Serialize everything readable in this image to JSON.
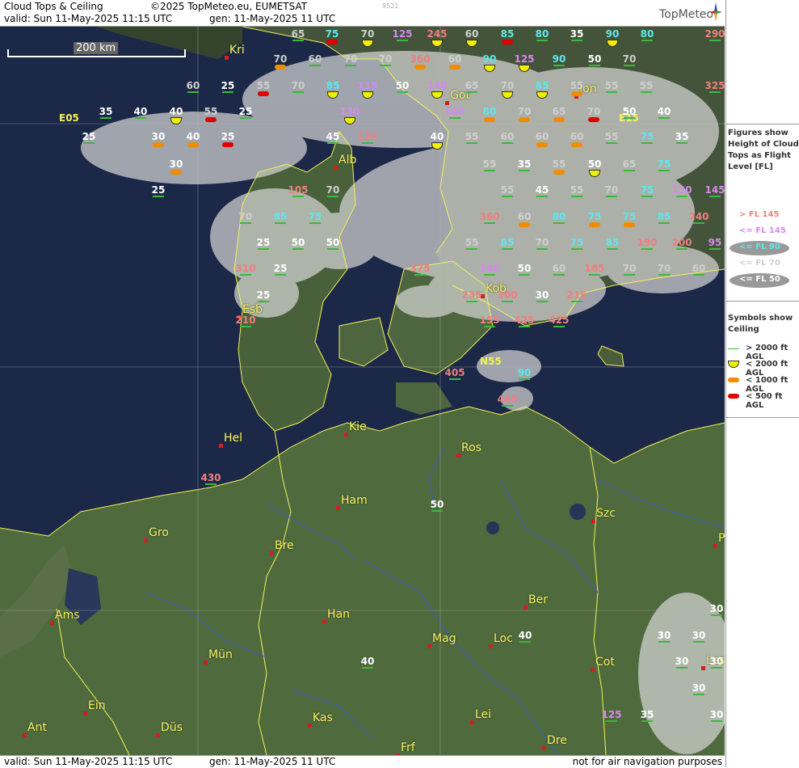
{
  "header": {
    "title": "Cloud Tops & Ceiling",
    "copyright": "©2025 TopMeteo.eu, EUMETSAT",
    "id": "9521",
    "valid": "valid:  Sun  11-May-2025  11:15 UTC",
    "generated": "gen: 11-May-2025 11 UTC",
    "brand": "TopMeteo"
  },
  "map": {
    "scale_label": "200 km",
    "grid_labels": [
      {
        "id": "e05",
        "text": "E05"
      },
      {
        "id": "e15",
        "text": "E15"
      },
      {
        "id": "n55",
        "text": "N55"
      }
    ],
    "cities": [
      {
        "name": "Kri"
      },
      {
        "name": "Got"
      },
      {
        "name": "Jon"
      },
      {
        "name": "Alb"
      },
      {
        "name": "Esb"
      },
      {
        "name": "Kob"
      },
      {
        "name": "Hel"
      },
      {
        "name": "Kie"
      },
      {
        "name": "Ros"
      },
      {
        "name": "Ham"
      },
      {
        "name": "Szc"
      },
      {
        "name": "Gro"
      },
      {
        "name": "Bre"
      },
      {
        "name": "Ber"
      },
      {
        "name": "Ams"
      },
      {
        "name": "Han"
      },
      {
        "name": "Mün"
      },
      {
        "name": "Mag"
      },
      {
        "name": "Loc"
      },
      {
        "name": "Cot"
      },
      {
        "name": "Ein"
      },
      {
        "name": "Kas"
      },
      {
        "name": "Lei"
      },
      {
        "name": "Ant"
      },
      {
        "name": "Düs"
      },
      {
        "name": "Frf"
      },
      {
        "name": "Dre"
      },
      {
        "name": "Les"
      },
      {
        "name": "Po"
      }
    ],
    "cloud_tops": [
      {
        "v": "65",
        "c": "gray",
        "s": "green"
      },
      {
        "v": "75",
        "c": "cyan",
        "s": "red"
      },
      {
        "v": "70",
        "c": "gray",
        "s": "yellow"
      },
      {
        "v": "125",
        "c": "purple",
        "s": "green"
      },
      {
        "v": "245",
        "c": "pink",
        "s": "yellow"
      },
      {
        "v": "60",
        "c": "gray",
        "s": "yellow"
      },
      {
        "v": "85",
        "c": "cyan",
        "s": "red"
      },
      {
        "v": "80",
        "c": "cyan",
        "s": "green"
      },
      {
        "v": "35",
        "c": "white",
        "s": "green"
      },
      {
        "v": "90",
        "c": "cyan",
        "s": "yellow"
      },
      {
        "v": "80",
        "c": "cyan",
        "s": "green"
      },
      {
        "v": "290",
        "c": "pink",
        "s": "green"
      },
      {
        "v": "70",
        "c": "gray",
        "s": "orange"
      },
      {
        "v": "60",
        "c": "gray",
        "s": "green"
      },
      {
        "v": "70",
        "c": "gray",
        "s": "green"
      },
      {
        "v": "70",
        "c": "gray",
        "s": "green"
      },
      {
        "v": "360",
        "c": "pink",
        "s": "orange"
      },
      {
        "v": "60",
        "c": "gray",
        "s": "orange"
      },
      {
        "v": "90",
        "c": "cyan",
        "s": "yellow"
      },
      {
        "v": "125",
        "c": "purple",
        "s": "yellow"
      },
      {
        "v": "90",
        "c": "cyan",
        "s": "green"
      },
      {
        "v": "50",
        "c": "white",
        "s": "green"
      },
      {
        "v": "70",
        "c": "gray",
        "s": "green"
      },
      {
        "v": "60",
        "c": "gray",
        "s": "green"
      },
      {
        "v": "25",
        "c": "white",
        "s": "green"
      },
      {
        "v": "55",
        "c": "gray",
        "s": "red"
      },
      {
        "v": "70",
        "c": "gray",
        "s": "green"
      },
      {
        "v": "85",
        "c": "cyan",
        "s": "yellow"
      },
      {
        "v": "115",
        "c": "purple",
        "s": "yellow"
      },
      {
        "v": "50",
        "c": "white",
        "s": "green"
      },
      {
        "v": "140",
        "c": "purple",
        "s": "yellow"
      },
      {
        "v": "65",
        "c": "gray",
        "s": "green"
      },
      {
        "v": "70",
        "c": "gray",
        "s": "yellow"
      },
      {
        "v": "85",
        "c": "cyan",
        "s": "yellow"
      },
      {
        "v": "55",
        "c": "gray",
        "s": "orange"
      },
      {
        "v": "55",
        "c": "gray",
        "s": "green"
      },
      {
        "v": "55",
        "c": "gray",
        "s": "green"
      },
      {
        "v": "325",
        "c": "pink",
        "s": "green"
      },
      {
        "v": "35",
        "c": "white",
        "s": "green"
      },
      {
        "v": "40",
        "c": "white",
        "s": "green"
      },
      {
        "v": "40",
        "c": "white",
        "s": "yellow"
      },
      {
        "v": "55",
        "c": "gray",
        "s": "red"
      },
      {
        "v": "25",
        "c": "white",
        "s": "green"
      },
      {
        "v": "130",
        "c": "purple",
        "s": "yellow"
      },
      {
        "v": "140",
        "c": "purple",
        "s": "green"
      },
      {
        "v": "80",
        "c": "cyan",
        "s": "orange"
      },
      {
        "v": "70",
        "c": "gray",
        "s": "orange"
      },
      {
        "v": "65",
        "c": "gray",
        "s": "orange"
      },
      {
        "v": "70",
        "c": "gray",
        "s": "red"
      },
      {
        "v": "50",
        "c": "white",
        "s": "green"
      },
      {
        "v": "40",
        "c": "white",
        "s": "green"
      },
      {
        "v": "25",
        "c": "white",
        "s": "green"
      },
      {
        "v": "30",
        "c": "white",
        "s": "orange"
      },
      {
        "v": "40",
        "c": "white",
        "s": "orange"
      },
      {
        "v": "25",
        "c": "white",
        "s": "red"
      },
      {
        "v": "45",
        "c": "white",
        "s": "green"
      },
      {
        "v": "135",
        "c": "pink",
        "s": "green"
      },
      {
        "v": "40",
        "c": "white",
        "s": "yellow"
      },
      {
        "v": "55",
        "c": "gray",
        "s": "green"
      },
      {
        "v": "60",
        "c": "gray",
        "s": "green"
      },
      {
        "v": "60",
        "c": "gray",
        "s": "orange"
      },
      {
        "v": "60",
        "c": "gray",
        "s": "orange"
      },
      {
        "v": "55",
        "c": "gray",
        "s": "green"
      },
      {
        "v": "75",
        "c": "cyan",
        "s": "green"
      },
      {
        "v": "35",
        "c": "white",
        "s": "green"
      },
      {
        "v": "30",
        "c": "white",
        "s": "orange"
      },
      {
        "v": "55",
        "c": "gray",
        "s": "green"
      },
      {
        "v": "35",
        "c": "white",
        "s": "green"
      },
      {
        "v": "55",
        "c": "gray",
        "s": "orange"
      },
      {
        "v": "50",
        "c": "white",
        "s": "yellow"
      },
      {
        "v": "65",
        "c": "gray",
        "s": "green"
      },
      {
        "v": "75",
        "c": "cyan",
        "s": "green"
      },
      {
        "v": "25",
        "c": "white",
        "s": "green"
      },
      {
        "v": "105",
        "c": "pink",
        "s": "green"
      },
      {
        "v": "70",
        "c": "gray",
        "s": "green"
      },
      {
        "v": "55",
        "c": "gray",
        "s": "green"
      },
      {
        "v": "45",
        "c": "white",
        "s": "green"
      },
      {
        "v": "55",
        "c": "gray",
        "s": "green"
      },
      {
        "v": "70",
        "c": "gray",
        "s": "green"
      },
      {
        "v": "75",
        "c": "cyan",
        "s": "green"
      },
      {
        "v": "130",
        "c": "purple",
        "s": "green"
      },
      {
        "v": "145",
        "c": "purple",
        "s": "green"
      },
      {
        "v": "70",
        "c": "gray",
        "s": "green"
      },
      {
        "v": "85",
        "c": "cyan",
        "s": "green"
      },
      {
        "v": "75",
        "c": "cyan",
        "s": "green"
      },
      {
        "v": "360",
        "c": "pink",
        "s": "green"
      },
      {
        "v": "60",
        "c": "gray",
        "s": "orange"
      },
      {
        "v": "80",
        "c": "cyan",
        "s": "green"
      },
      {
        "v": "75",
        "c": "cyan",
        "s": "orange"
      },
      {
        "v": "75",
        "c": "cyan",
        "s": "orange"
      },
      {
        "v": "85",
        "c": "cyan",
        "s": "green"
      },
      {
        "v": "240",
        "c": "pink",
        "s": "green"
      },
      {
        "v": "25",
        "c": "white",
        "s": "green"
      },
      {
        "v": "50",
        "c": "white",
        "s": "green"
      },
      {
        "v": "50",
        "c": "white",
        "s": "green"
      },
      {
        "v": "55",
        "c": "gray",
        "s": "green"
      },
      {
        "v": "85",
        "c": "cyan",
        "s": "green"
      },
      {
        "v": "70",
        "c": "gray",
        "s": "green"
      },
      {
        "v": "75",
        "c": "cyan",
        "s": "green"
      },
      {
        "v": "85",
        "c": "cyan",
        "s": "green"
      },
      {
        "v": "190",
        "c": "pink",
        "s": "green"
      },
      {
        "v": "200",
        "c": "pink",
        "s": "green"
      },
      {
        "v": "95",
        "c": "purple",
        "s": "green"
      },
      {
        "v": "310",
        "c": "pink",
        "s": "green"
      },
      {
        "v": "25",
        "c": "white",
        "s": "green"
      },
      {
        "v": "375",
        "c": "pink",
        "s": "green"
      },
      {
        "v": "140",
        "c": "purple",
        "s": "green"
      },
      {
        "v": "50",
        "c": "white",
        "s": "green"
      },
      {
        "v": "60",
        "c": "gray",
        "s": "green"
      },
      {
        "v": "185",
        "c": "pink",
        "s": "green"
      },
      {
        "v": "70",
        "c": "gray",
        "s": "green"
      },
      {
        "v": "70",
        "c": "gray",
        "s": "green"
      },
      {
        "v": "60",
        "c": "gray",
        "s": "green"
      },
      {
        "v": "25",
        "c": "white",
        "s": "green"
      },
      {
        "v": "235",
        "c": "pink",
        "s": "green"
      },
      {
        "v": "300",
        "c": "pink",
        "s": "green"
      },
      {
        "v": "30",
        "c": "white",
        "s": "green"
      },
      {
        "v": "215",
        "c": "pink",
        "s": "green"
      },
      {
        "v": "210",
        "c": "pink",
        "s": "green"
      },
      {
        "v": "155",
        "c": "pink",
        "s": "green"
      },
      {
        "v": "425",
        "c": "pink",
        "s": "green"
      },
      {
        "v": "425",
        "c": "pink",
        "s": "green"
      },
      {
        "v": "405",
        "c": "pink",
        "s": "green"
      },
      {
        "v": "90",
        "c": "cyan",
        "s": "green"
      },
      {
        "v": "445",
        "c": "pink",
        "s": "green"
      },
      {
        "v": "430",
        "c": "pink",
        "s": "green"
      },
      {
        "v": "50",
        "c": "white",
        "s": "green"
      },
      {
        "v": "30",
        "c": "white",
        "s": "green"
      },
      {
        "v": "40",
        "c": "white",
        "s": "green"
      },
      {
        "v": "30",
        "c": "white",
        "s": "green"
      },
      {
        "v": "30",
        "c": "white",
        "s": "green"
      },
      {
        "v": "40",
        "c": "white",
        "s": "green"
      },
      {
        "v": "30",
        "c": "white",
        "s": "green"
      },
      {
        "v": "30",
        "c": "white",
        "s": "green"
      },
      {
        "v": "125",
        "c": "purple",
        "s": "green"
      },
      {
        "v": "35",
        "c": "white",
        "s": "green"
      },
      {
        "v": "30",
        "c": "white",
        "s": "green"
      },
      {
        "v": "30",
        "c": "white",
        "s": "green"
      }
    ]
  },
  "legend": {
    "figures_title": "Figures show Height of Cloud Tops as Flight Level  [FL]",
    "fl_items": [
      {
        "label": "> FL 145",
        "color": "#f07f7f",
        "ellipse": false
      },
      {
        "label": "<= FL 145",
        "color": "#d489ee",
        "ellipse": false
      },
      {
        "label": "<= FL 90",
        "color": "#5ee8ea",
        "ellipse": true
      },
      {
        "label": "<= FL 70",
        "color": "#cfcfcf",
        "ellipse": false
      },
      {
        "label": "<= FL 50",
        "color": "#ffffff",
        "ellipse": true
      }
    ],
    "symbols_title": "Symbols show Ceiling",
    "symbol_items": [
      {
        "label": "> 2000 ft AGL",
        "symbol": "green-line"
      },
      {
        "label": "< 2000 ft AGL",
        "symbol": "yellow-half"
      },
      {
        "label": "< 1000 ft AGL",
        "symbol": "orange-pill"
      },
      {
        "label": "< 500 ft AGL",
        "symbol": "red-pill"
      }
    ]
  },
  "footer": {
    "valid": "valid:  Sun  11-May-2025  11:15 UTC",
    "generated": "gen: 11-May-2025 11 UTC",
    "note": "not for air navigation purposes"
  }
}
